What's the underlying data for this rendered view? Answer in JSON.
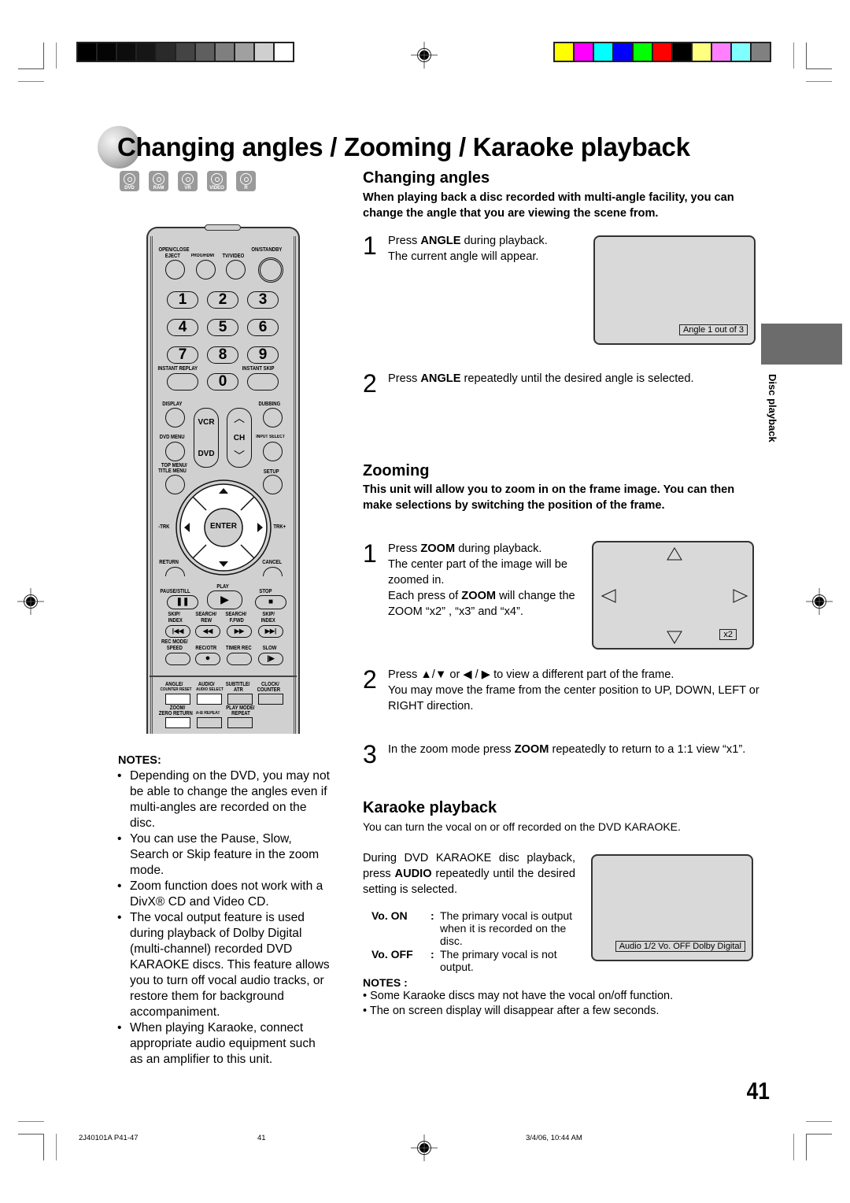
{
  "page": {
    "title": "Changing angles / Zooming / Karaoke playback",
    "disc_types": [
      "DVD",
      "RAM",
      "VR",
      "VIDEO",
      "R"
    ],
    "side_tab_label": "Disc playback",
    "page_number": "41"
  },
  "print_marks": {
    "grayscale_bar": [
      "#000000",
      "#050505",
      "#0d0d0d",
      "#161616",
      "#2a2a2a",
      "#444444",
      "#5f5f5f",
      "#7f7f7f",
      "#a0a0a0",
      "#cfcfcf",
      "#ffffff"
    ],
    "color_bar": [
      "#ffff00",
      "#ff00ff",
      "#00ffff",
      "#0000ff",
      "#00ff00",
      "#ff0000",
      "#000000",
      "#ffff80",
      "#ff80ff",
      "#80ffff",
      "#808080"
    ]
  },
  "remote": {
    "labels": {
      "open_close": "OPEN/CLOSE",
      "eject": "EJECT",
      "prog_hdmi": "PROG/HDMI",
      "tv_video": "TV/VIDEO",
      "on_standby": "ON/STANDBY",
      "instant_replay": "INSTANT REPLAY",
      "instant_skip": "INSTANT SKIP",
      "display": "DISPLAY",
      "dubbing": "DUBBING",
      "vcr": "VCR",
      "dvd": "DVD",
      "ch": "CH",
      "dvd_menu": "DVD MENU",
      "input_select": "INPUT SELECT",
      "top_menu": "TOP MENU/",
      "title_menu": "TITLE MENU",
      "setup": "SETUP",
      "trk_minus": "-TRK",
      "trk_plus": "TRK+",
      "enter": "ENTER",
      "return": "RETURN",
      "cancel": "CANCEL",
      "play": "PLAY",
      "pause_still": "PAUSE/STILL",
      "stop": "STOP",
      "skip_index_1": "SKIP/",
      "skip_index_2": "INDEX",
      "search_rew_1": "SEARCH/",
      "search_rew_2": "REW",
      "search_ffwd_1": "SEARCH/",
      "search_ffwd_2": "F.FWD",
      "rec_mode_1": "REC MODE/",
      "rec_mode_2": "SPEED",
      "rec_otr": "REC/OTR",
      "timer_rec": "TIMER REC",
      "slow": "SLOW",
      "angle_1": "ANGLE/",
      "angle_2": "COUNTER RESET",
      "audio_1": "AUDIO/",
      "audio_2": "AUDIO SELECT",
      "subtitle_1": "SUBTITLE/",
      "subtitle_2": "ATR",
      "clock_1": "CLOCK/",
      "clock_2": "COUNTER",
      "zoom_1": "ZOOM/",
      "zoom_2": "ZERO RETURN",
      "ab_repeat": "A-B REPEAT",
      "play_mode_1": "PLAY MODE/",
      "play_mode_2": "REPEAT"
    },
    "digits": [
      "1",
      "2",
      "3",
      "4",
      "5",
      "6",
      "7",
      "8",
      "9",
      "0"
    ]
  },
  "left_notes": {
    "title": "NOTES:",
    "items": [
      "Depending on the DVD, you may not be able to change the angles even if multi-angles are recorded on the disc.",
      "You can use the Pause, Slow, Search or Skip feature in the zoom mode.",
      "Zoom function does not work with a DivX® CD and Video CD.",
      "The vocal output feature is used during playback of Dolby Digital (multi-channel) recorded DVD KARAOKE discs. This feature allows you to turn off vocal audio tracks, or restore them for background accompaniment.",
      "When playing Karaoke, connect appropriate audio equipment such as an amplifier to this unit."
    ]
  },
  "angles": {
    "heading": "Changing angles",
    "lead": "When playing back a disc recorded with multi-angle facility, you can change the angle that you are viewing the scene from.",
    "step1_num": "1",
    "step1_pre": "Press ",
    "step1_key": "ANGLE",
    "step1_post": " during playback.",
    "step1_line2": "The current angle will appear.",
    "osd": "Angle 1 out of 3",
    "step2_num": "2",
    "step2_pre": "Press ",
    "step2_key": "ANGLE",
    "step2_post": " repeatedly until the desired angle is selected."
  },
  "zooming": {
    "heading": "Zooming",
    "lead": "This unit will allow you to zoom in on the frame image. You can then make selections by switching the position of the frame.",
    "step1_num": "1",
    "step1_pre": "Press ",
    "step1_key": "ZOOM",
    "step1_post": " during playback.",
    "step1_line2": "The center part of the image will be zoomed in.",
    "step1_line3_pre": "Each press of ",
    "step1_line3_key": "ZOOM",
    "step1_line3_post": " will change the ZOOM “x2” , “x3” and “x4”.",
    "osd": "x2",
    "step2_num": "2",
    "step2_pre": "Press ",
    "step2_arrows_ud": "▲/▼",
    "step2_or": " or ",
    "step2_arrows_lr": "◀ / ▶",
    "step2_post": " to view a different part of the frame.",
    "step2_line2": "You may move the frame from the center position to UP, DOWN, LEFT or RIGHT direction.",
    "step3_num": "3",
    "step3_pre": "In the zoom mode press ",
    "step3_key": "ZOOM",
    "step3_post": " repeatedly to return to a 1:1 view “x1”."
  },
  "karaoke": {
    "heading": "Karaoke playback",
    "intro": "You can turn the vocal on or off recorded on the DVD KARAOKE.",
    "instr_pre": "During DVD KARAOKE disc playback, press ",
    "instr_key": "AUDIO",
    "instr_post": " repeatedly until the desired setting is selected.",
    "options": [
      {
        "key": "Vo. ON",
        "sep": ":",
        "desc": "The primary vocal is output when it is recorded on the disc."
      },
      {
        "key": "Vo. OFF",
        "sep": ":",
        "desc": "The primary vocal is not output."
      }
    ],
    "osd": "Audio 1/2 Vo. OFF Dolby Digital",
    "notes_title": "NOTES :",
    "notes": [
      "Some Karaoke discs may not have the vocal on/off function.",
      "The on screen display will disappear after a few seconds."
    ]
  },
  "footer": {
    "doc_id": "2J40101A P41-47",
    "page": "41",
    "timestamp": "3/4/06, 10:44 AM"
  }
}
